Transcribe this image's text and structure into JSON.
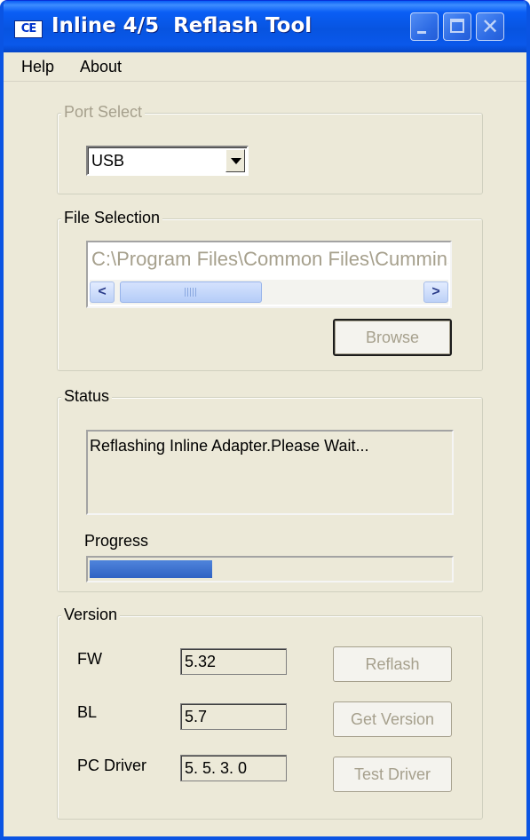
{
  "window": {
    "app_icon": "CE",
    "title": "Inline 4/5  Reflash Tool",
    "controls": [
      "minimize-icon",
      "maximize-icon",
      "close-icon"
    ]
  },
  "menu": {
    "items": [
      {
        "label": "Help"
      },
      {
        "label": "About"
      }
    ]
  },
  "port_select": {
    "legend": "Port Select",
    "value": "USB"
  },
  "file_selection": {
    "legend": "File Selection",
    "path": "C:\\Program Files\\Common Files\\Cummins",
    "browse_label": "Browse"
  },
  "status": {
    "legend": "Status",
    "message": "Reflashing Inline Adapter.Please Wait...",
    "progress_label": "Progress",
    "progress": 0.34
  },
  "version": {
    "legend": "Version",
    "fw_label": "FW",
    "fw_value": "5.32",
    "bl_label": "BL",
    "bl_value": "5.7",
    "pc_driver_label": "PC Driver",
    "pc_driver_value": "5. 5. 3. 0",
    "reflash_label": "Reflash",
    "get_version_label": "Get Version",
    "test_driver_label": "Test Driver"
  },
  "colors": {
    "titlebar": "#0a5ef5",
    "window_bg": "#ece9d8",
    "disabled_text": "#a6a08d",
    "progress_fill": "#2f62c3"
  }
}
